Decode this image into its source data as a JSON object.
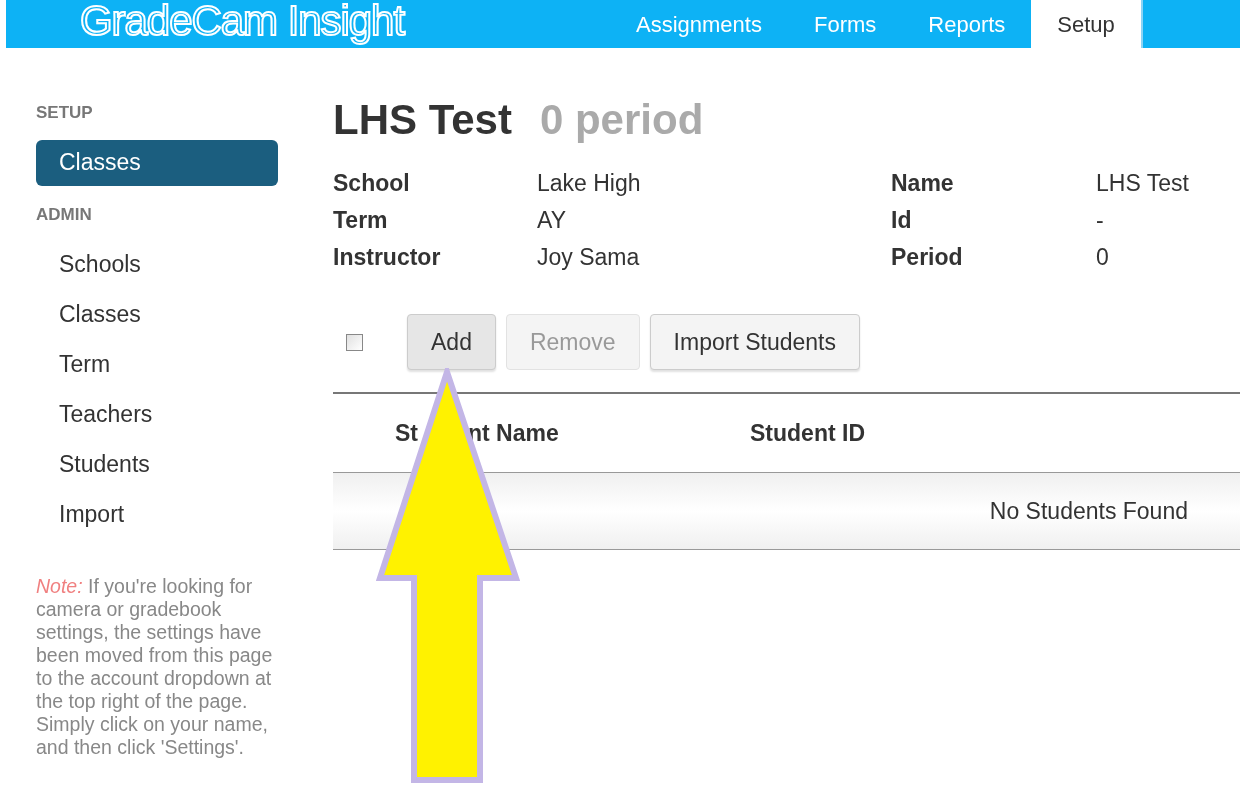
{
  "header": {
    "logo": "GradeCam Insight",
    "tabs": [
      {
        "label": "Assignments",
        "selected": false
      },
      {
        "label": "Forms",
        "selected": false
      },
      {
        "label": "Reports",
        "selected": false
      },
      {
        "label": "Setup",
        "selected": true
      }
    ]
  },
  "sidebar": {
    "sections": [
      {
        "heading": "SETUP",
        "items": [
          {
            "label": "Classes",
            "selected": true
          }
        ]
      },
      {
        "heading": "ADMIN",
        "items": [
          {
            "label": "Schools",
            "selected": false
          },
          {
            "label": "Classes",
            "selected": false
          },
          {
            "label": "Term",
            "selected": false
          },
          {
            "label": "Teachers",
            "selected": false
          },
          {
            "label": "Students",
            "selected": false
          },
          {
            "label": "Import",
            "selected": false
          }
        ]
      }
    ],
    "note": "*Note:* If you're looking for camera or gradebook settings, the settings have been moved from this page to the account dropdown at the top right of the page. Simply click on your name, and then click 'Settings'."
  },
  "page": {
    "title": "LHS Test",
    "subtitle": "0 period",
    "details_left": [
      {
        "label": "School",
        "value": "Lake High"
      },
      {
        "label": "Term",
        "value": "AY"
      },
      {
        "label": "Instructor",
        "value": "Joy Sama"
      }
    ],
    "details_right": [
      {
        "label": "Name",
        "value": "LHS Test"
      },
      {
        "label": "Id",
        "value": "-"
      },
      {
        "label": "Period",
        "value": "0"
      }
    ],
    "select_all": {
      "checked": false
    },
    "buttons": [
      {
        "label": "Add",
        "disabled": false,
        "pressed": true
      },
      {
        "label": "Remove",
        "disabled": true,
        "pressed": false
      },
      {
        "label": "Import Students",
        "disabled": false,
        "pressed": false
      }
    ],
    "table": {
      "columns": [
        {
          "texts": [
            "St",
            "nt Name"
          ]
        },
        {
          "texts": [
            "Student ID"
          ]
        }
      ],
      "empty_message": "No Students Found"
    }
  },
  "annotation": {
    "kind": "arrow"
  }
}
